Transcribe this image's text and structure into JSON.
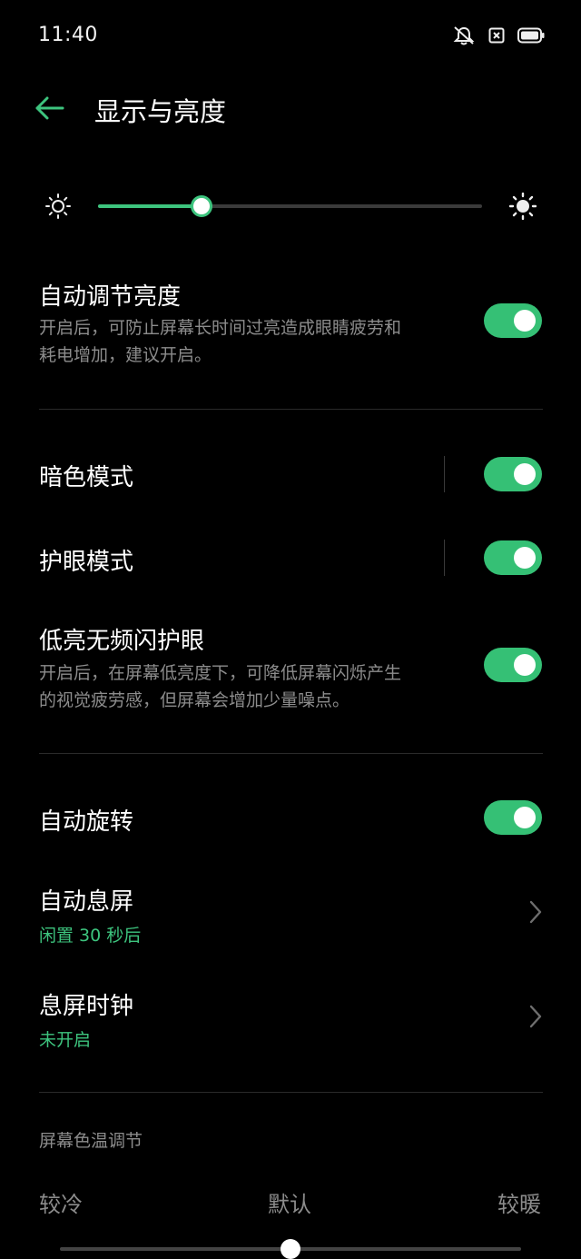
{
  "status_bar": {
    "time": "11:40",
    "icons": [
      "mute-icon",
      "sim-icon",
      "battery-icon"
    ]
  },
  "header": {
    "title": "显示与亮度",
    "back_icon": "arrow-left-icon"
  },
  "brightness": {
    "level_fraction": 0.27,
    "low_icon": "sun-small-icon",
    "high_icon": "sun-large-icon"
  },
  "auto_brightness": {
    "title": "自动调节亮度",
    "desc_line1": "开启后，可防止屏幕长时间过亮造成眼睛疲劳和",
    "desc_line2": "耗电增加，建议开启。",
    "enabled": true
  },
  "dark_mode": {
    "title": "暗色模式",
    "enabled": true
  },
  "eye_care": {
    "title": "护眼模式",
    "enabled": true
  },
  "dc_dimming": {
    "title": "低亮无频闪护眼",
    "desc_line1": "开启后，在屏幕低亮度下，可降低屏幕闪烁产生",
    "desc_line2": "的视觉疲劳感，但屏幕会增加少量噪点。",
    "enabled": true
  },
  "auto_rotate": {
    "title": "自动旋转",
    "enabled": true
  },
  "screen_timeout": {
    "title": "自动息屏",
    "value": "闲置 30 秒后"
  },
  "aod_clock": {
    "title": "息屏时钟",
    "value": "未开启"
  },
  "color_temp": {
    "section_title": "屏幕色温调节",
    "cold": "较冷",
    "default": "默认",
    "warm": "较暖",
    "level_fraction": 0.5
  },
  "colors": {
    "accent": "#3dc47e",
    "background": "#000000",
    "secondary_text": "#8c8c8c"
  }
}
